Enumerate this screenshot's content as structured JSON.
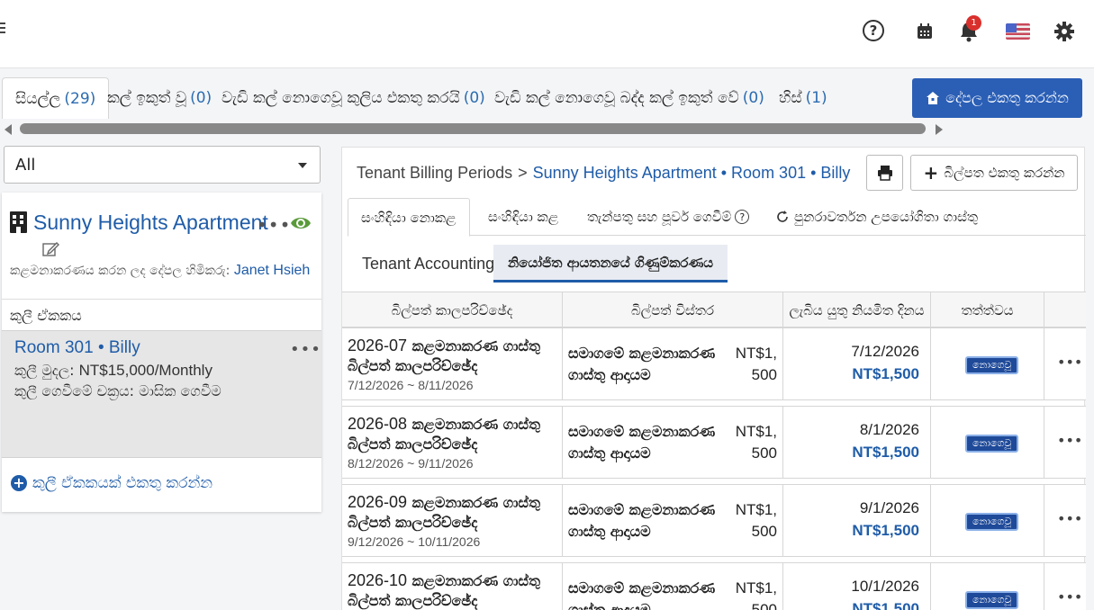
{
  "header": {
    "help_symbol": "?",
    "notifications_count": "1"
  },
  "filter_tabs": [
    {
      "label": "සියල්ල",
      "count": "(29)"
    },
    {
      "label": "කල් ඉකුත් වූ",
      "count": "(0)"
    },
    {
      "label": "වැඩි කල් නොගෙවූ කුලිය එකතු කරයි",
      "count": "(0)"
    },
    {
      "label": "වැඩි කල් නොගෙවූ බද්ද කල් ඉකුත් වේ",
      "count": "(0)"
    },
    {
      "label": "හිස්",
      "count": "(1)"
    }
  ],
  "add_property_label": "දේපල එකතු කරන්න",
  "select": {
    "value": "All"
  },
  "property": {
    "name": "Sunny Heights Apartment",
    "manager_label": "කළමනාකරණය කරන ලද දේපල හිමිකරු:",
    "manager_name": "Janet Hsieh",
    "more": "•••"
  },
  "unit_section_label": "කුලී ඒකකය",
  "unit": {
    "title": "Room 301 • Billy",
    "rent_label": "කුලී මුදල:",
    "rent_value": "NT$15,000/Monthly",
    "cycle": "කුලී ගෙවීමේ චක්‍රය: මාසික ගෙවීම",
    "more": "•••"
  },
  "add_unit_label": "කුලී ඒකකයක් එකතු කරන්න",
  "breadcrumb": {
    "root": "Tenant Billing Periods",
    "sep": ">",
    "current": "Sunny Heights Apartment • Room 301 • Billy"
  },
  "add_bill_label": "බිල්පත එකතු කරන්න",
  "panel_tabs": [
    {
      "label": "සංහිඳියා නොකළ"
    },
    {
      "label": "සංහිඳියා කළ"
    },
    {
      "label": "තැන්පතු සහ පූර්ව ගෙවීම්"
    },
    {
      "label": "පුනරාවර්තන උපයෝගිතා ගාස්තු"
    }
  ],
  "sub_tabs": [
    {
      "label": "Tenant Accounting"
    },
    {
      "label": "නියෝජිත ආයතනයේ ගිණුම්කරණය"
    }
  ],
  "table": {
    "headers": [
      "බිල්පත් කාලපරිච්ඡේද",
      "බිල්පත් විස්තර",
      "ලැබිය යුතු නියමිත දිනය",
      "තත්ත්වය"
    ],
    "rows": [
      {
        "period_code": "2026-07",
        "period_title": "කළමනාකරණ ගාස්තු බිල්පත් කාලපරිච්ඡේද",
        "range": "7/12/2026 ~ 8/11/2026",
        "item": "සමාගමේ කළමනාකරණ ගාස්තු ආදායම",
        "amount": "NT$1, 500",
        "due_date": "7/12/2026",
        "due_amount": "NT$1,500",
        "status": "නොගෙවූ"
      },
      {
        "period_code": "2026-08",
        "period_title": "කළමනාකරණ ගාස්තු බිල්පත් කාලපරිච්ඡේද",
        "range": "8/12/2026 ~ 9/11/2026",
        "item": "සමාගමේ කළමනාකරණ ගාස්තු ආදායම",
        "amount": "NT$1, 500",
        "due_date": "8/1/2026",
        "due_amount": "NT$1,500",
        "status": "නොගෙවූ"
      },
      {
        "period_code": "2026-09",
        "period_title": "කළමනාකරණ ගාස්තු බිල්පත් කාලපරිච්ඡේද",
        "range": "9/12/2026 ~ 10/11/2026",
        "item": "සමාගමේ කළමනාකරණ ගාස්තු ආදායම",
        "amount": "NT$1, 500",
        "due_date": "9/1/2026",
        "due_amount": "NT$1,500",
        "status": "නොගෙවූ"
      },
      {
        "period_code": "2026-10",
        "period_title": "කළමනාකරණ ගාස්තු බිල්පත් කාලපරිච්ඡේද",
        "range": "",
        "item": "සමාගමේ කළමනාකරණ ගාස්තු ආදායම",
        "amount": "NT$1, 500",
        "due_date": "10/1/2026",
        "due_amount": "NT$1,500",
        "status": "නොගෙවූ"
      }
    ],
    "row_more": "•••"
  },
  "colors": {
    "accent": "#1f5ca8",
    "primary_button": "#2b5fb6",
    "badge": "#1f4a99",
    "notification": "#d9302c"
  }
}
